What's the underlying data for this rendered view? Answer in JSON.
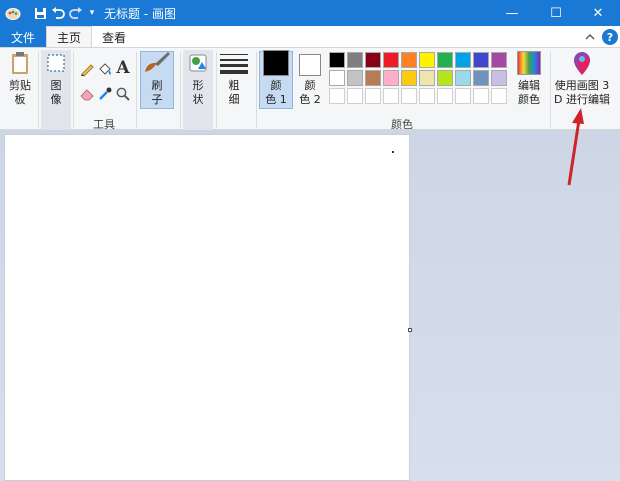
{
  "window": {
    "title": "无标题 - 画图",
    "controls": {
      "minimize": "—",
      "maximize": "☐",
      "close": "✕"
    }
  },
  "tabs": {
    "file": "文件",
    "home": "主页",
    "view": "查看"
  },
  "ribbon": {
    "clipboard": {
      "line1": "剪贴",
      "line2": "板"
    },
    "image": {
      "line1": "图",
      "line2": "像"
    },
    "tools_label": "工具",
    "text_tool": "A",
    "brushes": {
      "line1": "刷",
      "line2": "子"
    },
    "shapes": {
      "line1": "形",
      "line2": "状"
    },
    "size": {
      "line1": "粗",
      "line2": "细"
    },
    "color1": {
      "line1": "颜",
      "line2": "色 1"
    },
    "color2": {
      "line1": "颜",
      "line2": "色 2"
    },
    "edit_colors": {
      "line1": "编辑",
      "line2": "颜色"
    },
    "paint3d": {
      "line1": "使用画图 3",
      "line2": "D 进行编辑"
    },
    "colors_label": "颜色"
  },
  "palette": {
    "row1": [
      "#000000",
      "#7f7f7f",
      "#880015",
      "#ed1c24",
      "#ff7f27",
      "#fff200",
      "#22b14c",
      "#00a2e8",
      "#3f48cc",
      "#a349a4"
    ],
    "row2": [
      "#ffffff",
      "#c3c3c3",
      "#b97a57",
      "#ffaec9",
      "#ffc90e",
      "#efe4b0",
      "#b5e61d",
      "#99d9ea",
      "#7092be",
      "#c8bfe7"
    ],
    "row3": [
      "#ffffff",
      "#ffffff",
      "#ffffff",
      "#ffffff",
      "#ffffff",
      "#ffffff",
      "#ffffff",
      "#ffffff",
      "#ffffff",
      "#ffffff"
    ]
  },
  "current_colors": {
    "color1": "#000000",
    "color2": "#ffffff"
  },
  "accent": {
    "titlebar": "#1979d4",
    "annotation_arrow": "#d0232a"
  }
}
